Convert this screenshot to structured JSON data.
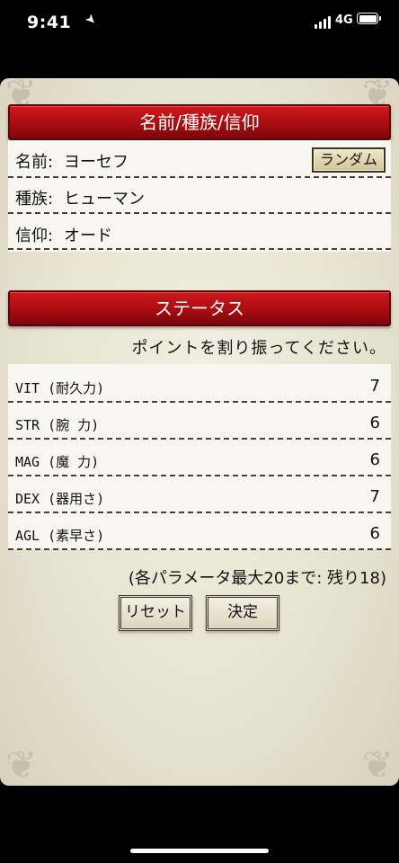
{
  "status_bar": {
    "time": "9:41",
    "network": "4G"
  },
  "header_banner": {
    "title": "名前/種族/信仰"
  },
  "profile": {
    "fields": [
      {
        "label": "名前",
        "value": "ヨーセフ"
      },
      {
        "label": "種族",
        "value": "ヒューマン"
      },
      {
        "label": "信仰",
        "value": "オード"
      }
    ],
    "random_button": "ランダム"
  },
  "status_banner": {
    "title": "ステータス"
  },
  "instruction": "ポイントを割り振ってください。",
  "stats": [
    {
      "label": "VIT (耐久力)",
      "value": "7"
    },
    {
      "label": "STR (腕  力)",
      "value": "6"
    },
    {
      "label": "MAG (魔  力)",
      "value": "6"
    },
    {
      "label": "DEX (器用さ)",
      "value": "7"
    },
    {
      "label": "AGL (素早さ)",
      "value": "6"
    }
  ],
  "limit_note": "(各パラメータ最大20まで: 残り18)",
  "buttons": {
    "reset": "リセット",
    "confirm": "決定"
  },
  "icons": [
    "location-arrow-icon",
    "signal-icon",
    "battery-icon",
    "corner-ornament-icon"
  ],
  "colors": {
    "banner_red": "#b01016",
    "parchment": "#ece8d8",
    "panel": "#f7f6f1"
  }
}
